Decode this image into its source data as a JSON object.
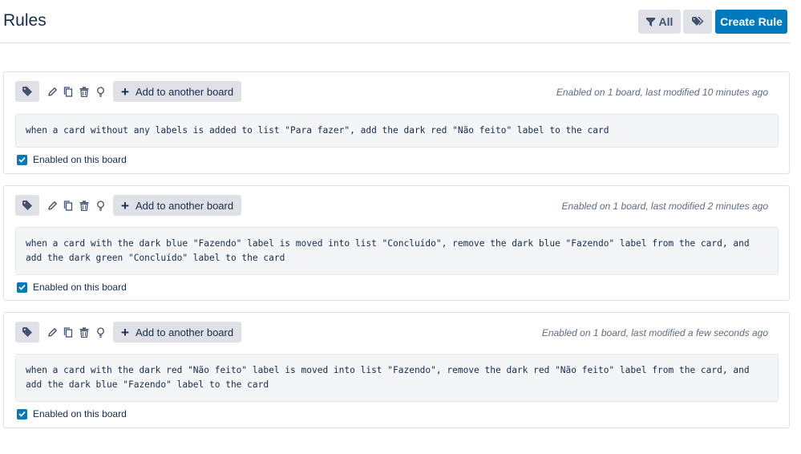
{
  "header": {
    "title": "Rules",
    "filter_label": "All",
    "filter_icon": "filter-icon",
    "labels_icon": "tags-icon",
    "create_label": "Create Rule"
  },
  "toolbar_icons": [
    "tag-icon",
    "pencil-icon",
    "copy-icon",
    "trash-icon",
    "lightbulb-icon"
  ],
  "rules": [
    {
      "meta": "Enabled on 1 board, last modified 10 minutes ago",
      "text": "when a card without any labels is added to list \"Para fazer\", add the dark red \"Não feito\" label to the card",
      "add_label": "Add to another board",
      "enabled_label": "Enabled on this board",
      "enabled": true
    },
    {
      "meta": "Enabled on 1 board, last modified 2 minutes ago",
      "text": "when a card with the dark blue \"Fazendo\" label is moved into list \"Concluído\", remove the dark blue \"Fazendo\" label from the card, and\nadd the dark green \"Concluído\" label to the card",
      "add_label": "Add to another board",
      "enabled_label": "Enabled on this board",
      "enabled": true
    },
    {
      "meta": "Enabled on 1 board, last modified a few seconds ago",
      "text": "when a card with the dark red \"Não feito\" label is moved into list \"Fazendo\", remove the dark red \"Não feito\" label from the card, and\nadd the dark blue \"Fazendo\" label to the card",
      "add_label": "Add to another board",
      "enabled_label": "Enabled on this board",
      "enabled": true
    }
  ]
}
